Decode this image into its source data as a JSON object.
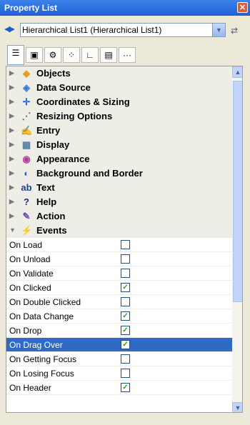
{
  "window": {
    "title": "Property List",
    "close_glyph": "✕"
  },
  "selector": {
    "value": "Hierarchical List1 (Hierarchical List1)",
    "nav_glyph": "◀▶",
    "drop_glyph": "▼",
    "extra_glyph": "⇄"
  },
  "tabs": [
    {
      "icon": "list-icon",
      "glyph": "☰"
    },
    {
      "icon": "form-icon",
      "glyph": "▣"
    },
    {
      "icon": "gear-icon",
      "glyph": "⚙"
    },
    {
      "icon": "shapes-icon",
      "glyph": "⁘"
    },
    {
      "icon": "chart-icon",
      "glyph": "∟"
    },
    {
      "icon": "monitor-icon",
      "glyph": "▤"
    },
    {
      "icon": "more-icon",
      "glyph": "···"
    }
  ],
  "categories": [
    {
      "label": "Objects",
      "icon": "objects-icon",
      "glyph": "◆",
      "color": "#e2a11a",
      "arrow": "▶"
    },
    {
      "label": "Data Source",
      "icon": "data-source-icon",
      "glyph": "◈",
      "color": "#3a7bd5",
      "arrow": "▶"
    },
    {
      "label": "Coordinates & Sizing",
      "icon": "coordinates-icon",
      "glyph": "✛",
      "color": "#2a6ad8",
      "arrow": "▶"
    },
    {
      "label": "Resizing Options",
      "icon": "resizing-icon",
      "glyph": "⋰",
      "color": "#6a6a6a",
      "arrow": "▶"
    },
    {
      "label": "Entry",
      "icon": "entry-icon",
      "glyph": "✍",
      "color": "#c0392b",
      "arrow": "▶"
    },
    {
      "label": "Display",
      "icon": "display-icon",
      "glyph": "▦",
      "color": "#557ea6",
      "arrow": "▶"
    },
    {
      "label": "Appearance",
      "icon": "appearance-icon",
      "glyph": "◉",
      "color": "#b03d9a",
      "arrow": "▶"
    },
    {
      "label": "Background and Border",
      "icon": "background-icon",
      "glyph": "◐",
      "color": "#2c69c8",
      "arrow": "▶"
    },
    {
      "label": "Text",
      "icon": "text-icon",
      "glyph": "ab",
      "color": "#1d3f8a",
      "arrow": "▶"
    },
    {
      "label": "Help",
      "icon": "help-icon",
      "glyph": "?",
      "color": "#1d2f7a",
      "arrow": "▶"
    },
    {
      "label": "Action",
      "icon": "action-icon",
      "glyph": "✎",
      "color": "#6b4cad",
      "arrow": "▶"
    },
    {
      "label": "Events",
      "icon": "events-icon",
      "glyph": "⚡",
      "color": "#d86f1a",
      "arrow": "▼"
    }
  ],
  "events": [
    {
      "label": "On Load",
      "checked": false,
      "selected": false
    },
    {
      "label": "On Unload",
      "checked": false,
      "selected": false
    },
    {
      "label": "On Validate",
      "checked": false,
      "selected": false
    },
    {
      "label": "On Clicked",
      "checked": true,
      "selected": false
    },
    {
      "label": "On Double Clicked",
      "checked": false,
      "selected": false
    },
    {
      "label": "On Data Change",
      "checked": true,
      "selected": false
    },
    {
      "label": "On Drop",
      "checked": true,
      "selected": false
    },
    {
      "label": "On Drag Over",
      "checked": true,
      "selected": true
    },
    {
      "label": "On Getting Focus",
      "checked": false,
      "selected": false
    },
    {
      "label": "On Losing Focus",
      "checked": false,
      "selected": false
    },
    {
      "label": "On Header",
      "checked": true,
      "selected": false
    }
  ],
  "check_glyph": "✓",
  "scroll": {
    "up_glyph": "▲",
    "down_glyph": "▼"
  }
}
